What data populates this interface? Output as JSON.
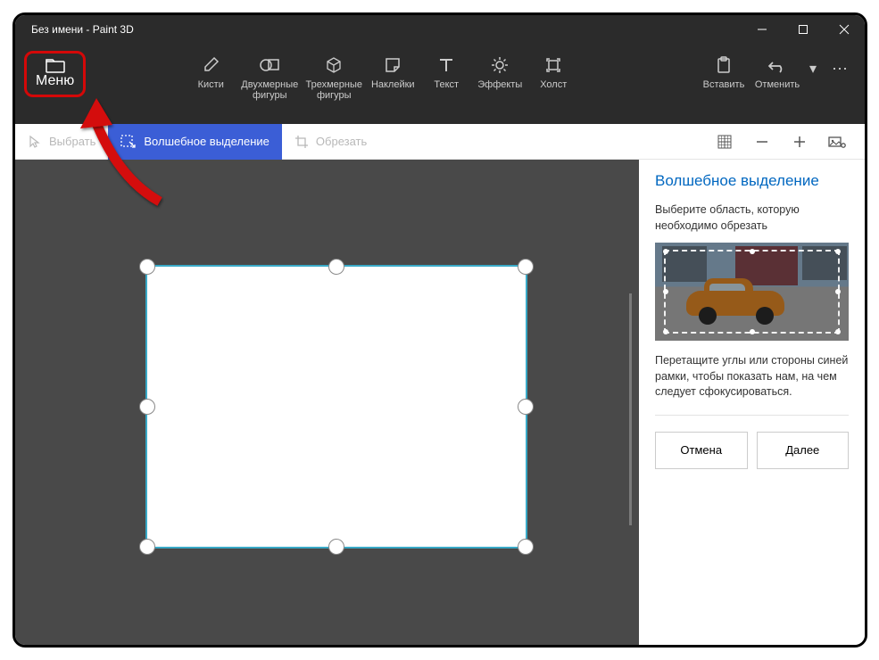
{
  "title": "Без имени - Paint 3D",
  "menu": {
    "label": "Меню"
  },
  "ribbon": {
    "items": [
      {
        "label": "Кисти"
      },
      {
        "label": "Двухмерные фигуры"
      },
      {
        "label": "Трехмерные фигуры"
      },
      {
        "label": "Наклейки"
      },
      {
        "label": "Текст"
      },
      {
        "label": "Эффекты"
      },
      {
        "label": "Холст"
      }
    ],
    "paste": "Вставить",
    "undo": "Отменить"
  },
  "toolbar": {
    "select": "Выбрать",
    "magic": "Волшебное выделение",
    "crop": "Обрезать"
  },
  "sidepanel": {
    "title": "Волшебное выделение",
    "sub": "Выберите область, которую необходимо обрезать",
    "hint": "Перетащите углы или стороны синей рамки, чтобы показать нам, на чем следует сфокусироваться.",
    "cancel": "Отмена",
    "next": "Далее"
  }
}
